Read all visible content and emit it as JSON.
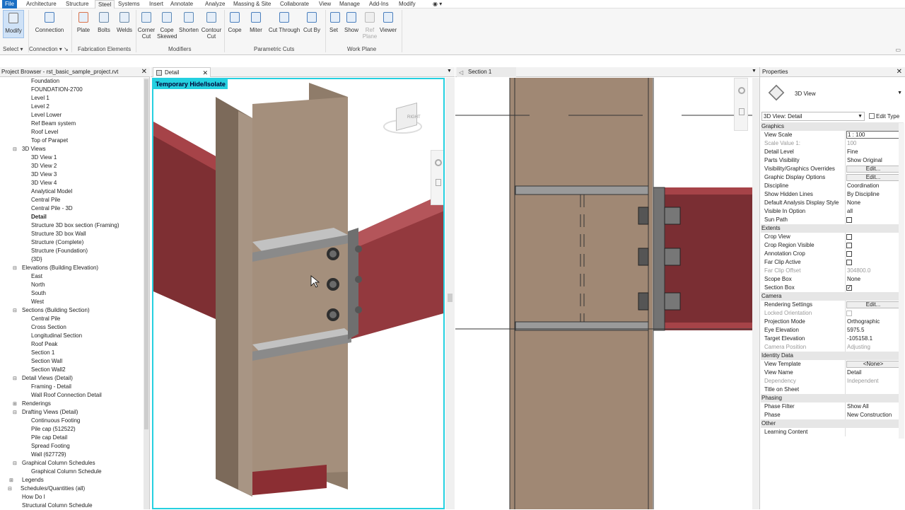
{
  "menu_tabs": [
    "File",
    "Architecture",
    "Structure",
    "Steel",
    "Systems",
    "Insert",
    "Annotate",
    "Analyze",
    "Massing & Site",
    "Collaborate",
    "View",
    "Manage",
    "Add-Ins",
    "Modify"
  ],
  "ribbon": {
    "buttons": [
      "Modify",
      "Connection",
      "Plate",
      "Bolts",
      "Welds",
      "Corner\nCut",
      "Cope\nSkewed",
      "Shorten",
      "Contour\nCut",
      "Cope",
      "Miter",
      "Cut Through",
      "Cut By",
      "Set",
      "Show",
      "Ref\nPlane",
      "Viewer"
    ],
    "panels": [
      "Select",
      "Connection",
      "Fabrication Elements",
      "Modifiers",
      "Parametric Cuts",
      "Work Plane"
    ]
  },
  "project_browser": {
    "title": "Project Browser - rst_basic_sample_project.rvt",
    "items": [
      "Foundation",
      "FOUNDATION-2700",
      "Level 1",
      "Level 2",
      "Level Lower",
      "Ref Beam system",
      "Roof Level",
      "Top of Parapet",
      "3D Views",
      "3D View 1",
      "3D View 2",
      "3D View 3",
      "3D View 4",
      "Analytical Model",
      "Central Pile",
      "Central Pile - 3D",
      "Detail",
      "Structure 3D box section (Framing)",
      "Structure 3D box Wall",
      "Structure (Complete)",
      "Structure (Foundation)",
      "{3D}",
      "Elevations (Building Elevation)",
      "East",
      "North",
      "South",
      "West",
      "Sections (Building Section)",
      "Central Pile",
      "Cross Section",
      "Longitudinal Section",
      "Roof Peak",
      "Section 1",
      "Section Wall",
      "Section Wall2",
      "Detail Views (Detail)",
      "Framing - Detail",
      "Wall Roof Connection Detail",
      "Renderings",
      "Drafting Views (Detail)",
      "Continuous Footing",
      "Pile cap (512522)",
      "Pile cap Detail",
      "Spread Footing",
      "Wall (627729)",
      "Graphical Column Schedules",
      "Graphical Column Schedule",
      "Legends",
      "Schedules/Quantities (all)",
      "How Do I",
      "Structural Column Schedule"
    ]
  },
  "views": {
    "detail_tab": "Detail",
    "section_tab": "Section 1",
    "banner": "Temporary Hide/Isolate",
    "viewcube_label": "RIGHT"
  },
  "properties": {
    "title": "Properties",
    "type_name": "3D View",
    "selector": "3D View: Detail",
    "edit_type": "Edit Type",
    "rows": [
      {
        "g": "Graphics"
      },
      {
        "k": "View Scale",
        "v": "1 : 100"
      },
      {
        "k": "Scale Value    1:",
        "v": "100",
        "dim": true
      },
      {
        "k": "Detail Level",
        "v": "Fine"
      },
      {
        "k": "Parts Visibility",
        "v": "Show Original"
      },
      {
        "k": "Visibility/Graphics Overrides",
        "btn": "Edit..."
      },
      {
        "k": "Graphic Display Options",
        "btn": "Edit..."
      },
      {
        "k": "Discipline",
        "v": "Coordination"
      },
      {
        "k": "Show Hidden Lines",
        "v": "By Discipline"
      },
      {
        "k": "Default Analysis Display Style",
        "v": "None"
      },
      {
        "k": "Visible In Option",
        "v": "all"
      },
      {
        "k": "Sun Path",
        "cb": false
      },
      {
        "g": "Extents"
      },
      {
        "k": "Crop View",
        "cb": false
      },
      {
        "k": "Crop Region Visible",
        "cb": false
      },
      {
        "k": "Annotation Crop",
        "cb": false
      },
      {
        "k": "Far Clip Active",
        "cb": false
      },
      {
        "k": "Far Clip Offset",
        "v": "304800.0",
        "dim": true
      },
      {
        "k": "Scope Box",
        "v": "None"
      },
      {
        "k": "Section Box",
        "cb": true
      },
      {
        "g": "Camera"
      },
      {
        "k": "Rendering Settings",
        "btn": "Edit..."
      },
      {
        "k": "Locked Orientation",
        "cb": false,
        "dim": true
      },
      {
        "k": "Projection Mode",
        "v": "Orthographic"
      },
      {
        "k": "Eye Elevation",
        "v": "5975.5"
      },
      {
        "k": "Target Elevation",
        "v": "-105158.1"
      },
      {
        "k": "Camera Position",
        "v": "Adjusting",
        "dim": true
      },
      {
        "g": "Identity Data"
      },
      {
        "k": "View Template",
        "btn": "<None>"
      },
      {
        "k": "View Name",
        "v": "Detail"
      },
      {
        "k": "Dependency",
        "v": "Independent",
        "dim": true
      },
      {
        "k": "Title on Sheet",
        "v": ""
      },
      {
        "g": "Phasing"
      },
      {
        "k": "Phase Filter",
        "v": "Show All"
      },
      {
        "k": "Phase",
        "v": "New Construction"
      },
      {
        "g": "Other"
      },
      {
        "k": "Learning Content",
        "v": ""
      }
    ]
  }
}
